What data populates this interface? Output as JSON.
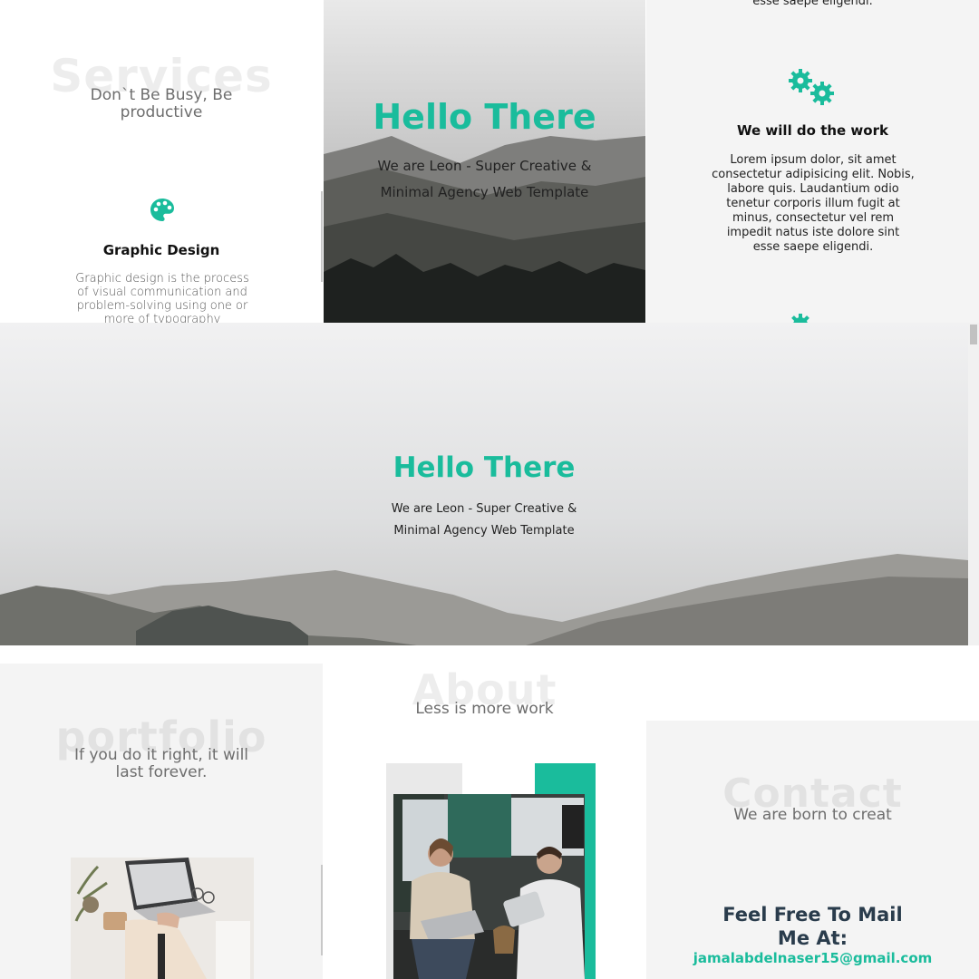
{
  "services": {
    "ghost_title": "Services",
    "subtitle": "Don`t Be Busy, Be productive",
    "item": {
      "icon": "palette-icon",
      "title": "Graphic Design",
      "description": "Graphic design is the process of visual communication and problem-solving using one or more of typography"
    }
  },
  "hero": {
    "title": "Hello There",
    "line1": "We are Leon - Super Creative &",
    "line2": "Minimal Agency Web Template"
  },
  "features": {
    "cut_text": "esse saepe eligendi.",
    "icon": "gears-icon",
    "title": "We will do the work",
    "description": "Lorem ipsum dolor, sit amet consectetur adipisicing elit. Nobis, labore quis. Laudantium odio tenetur corporis illum fugit at minus, consectetur vel rem impedit natus iste dolore sint esse saepe eligendi."
  },
  "portfolio": {
    "ghost_title": "portfolio",
    "subtitle": "If you do it right, it will last forever."
  },
  "about": {
    "ghost_title": "About",
    "subtitle": "Less is more work"
  },
  "contact": {
    "ghost_title": "Contact",
    "subtitle": "We are born to creat",
    "heading": "Feel Free To Mail Me At:",
    "email": "jamalabdelnaser15@gmail.com"
  },
  "colors": {
    "accent": "#1abc9c",
    "panel_gray": "#f4f4f4",
    "heading_dark": "#2a3c4c"
  }
}
